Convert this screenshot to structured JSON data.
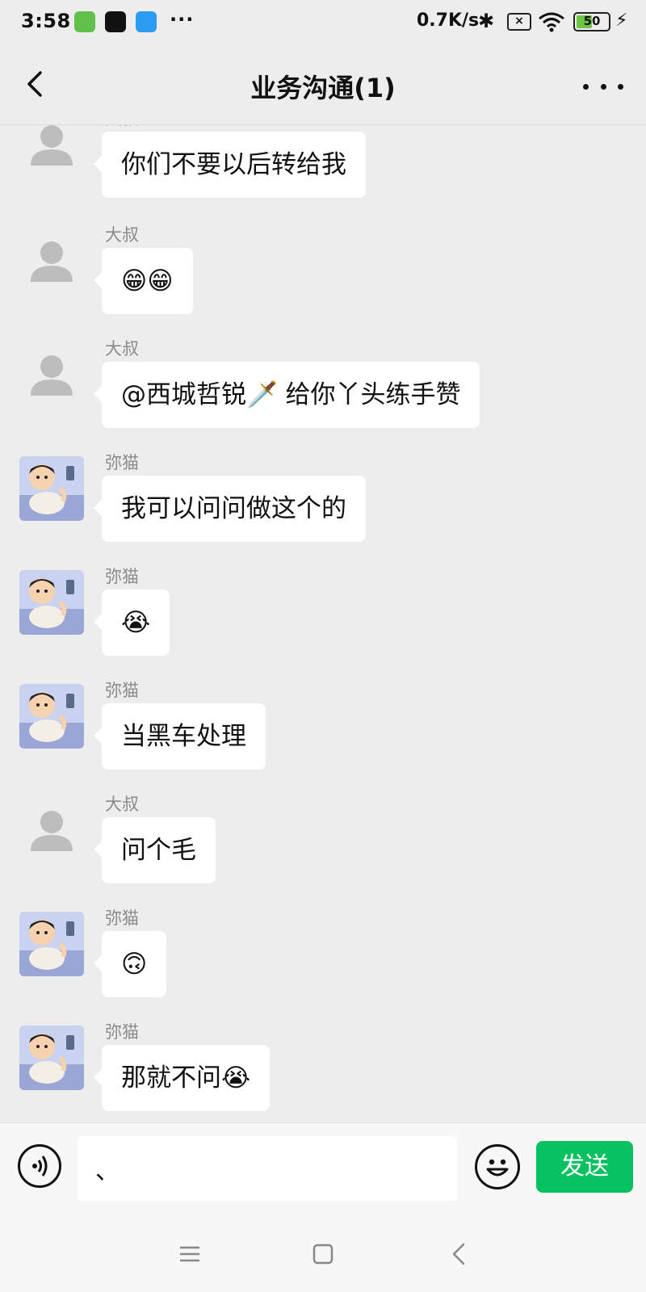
{
  "status_bar": {
    "time": "3:58",
    "more": "···",
    "net_speed": "0.7K/s",
    "bluetooth_icon": "bluetooth-icon",
    "sim_icon": "no-sim-icon",
    "wifi_icon": "wifi-icon",
    "battery_level": "50",
    "battery_fill": 0.5,
    "charging_icon": "bolt-icon"
  },
  "header": {
    "title": "业务沟通(1)",
    "back_icon": "chevron-left-icon",
    "more_icon": "more-dots-icon"
  },
  "messages": [
    {
      "sender": "大叔",
      "text": "你们不要以后转给我",
      "avatar": "default"
    },
    {
      "sender": "大叔",
      "text": "😁😁",
      "avatar": "default"
    },
    {
      "sender": "大叔",
      "text": "@西城哲锐🗡️ 给你丫头练手赞",
      "avatar": "default"
    },
    {
      "sender": "弥猫",
      "text": "我可以问问做这个的",
      "avatar": "cartoon"
    },
    {
      "sender": "弥猫",
      "text": "😭",
      "avatar": "cartoon"
    },
    {
      "sender": "弥猫",
      "text": "当黑车处理",
      "avatar": "cartoon"
    },
    {
      "sender": "大叔",
      "text": "问个毛",
      "avatar": "default"
    },
    {
      "sender": "弥猫",
      "text": "🙃",
      "avatar": "cartoon"
    },
    {
      "sender": "弥猫",
      "text": "那就不问😭",
      "avatar": "cartoon"
    }
  ],
  "input_bar": {
    "value": "、",
    "send_label": "发送",
    "voice_icon": "voice-icon",
    "emoji_icon": "emoji-icon"
  },
  "nav_bar": {
    "menu_icon": "menu-icon",
    "home_icon": "home-square-icon",
    "back_icon": "back-triangle-icon"
  },
  "colors": {
    "background": "#ededed",
    "bubble": "#ffffff",
    "send_button": "#07c160",
    "sender_name": "#8a8a8a"
  }
}
